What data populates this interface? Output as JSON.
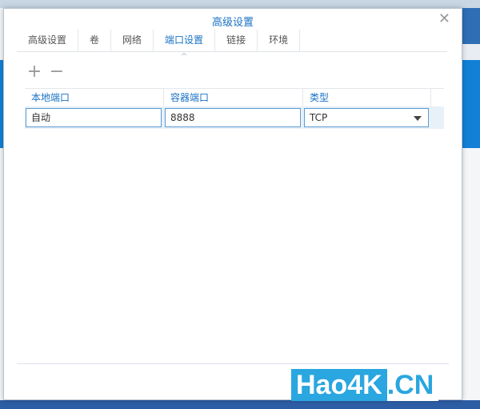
{
  "dialog": {
    "title": "高级设置",
    "close_icon": "close-icon"
  },
  "tabs": [
    {
      "label": "高级设置"
    },
    {
      "label": "卷"
    },
    {
      "label": "网络"
    },
    {
      "label": "端口设置",
      "active": true
    },
    {
      "label": "链接"
    },
    {
      "label": "环境"
    }
  ],
  "toolbar": {
    "add": "+",
    "remove": "−"
  },
  "table": {
    "columns": [
      "本地端口",
      "容器端口",
      "类型"
    ],
    "rows": [
      {
        "local_port": "自动",
        "container_port": "8888",
        "type": "TCP"
      }
    ]
  },
  "watermark": {
    "part1": "Hao4K",
    "part2": ".CN"
  }
}
